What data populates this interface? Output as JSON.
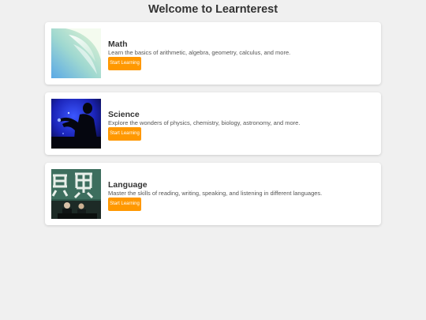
{
  "page": {
    "title": "Welcome to Learnterest"
  },
  "theme": {
    "background": "#f0f0f0",
    "card_background": "#ffffff",
    "accent": "#ff9800",
    "button_text": "#ffffff"
  },
  "courses": [
    {
      "title": "Math",
      "description": "Learn the basics of arithmetic, algebra, geometry, calculus, and more.",
      "button_label": "Start Learning",
      "image": "abstract-pastel-curve-image"
    },
    {
      "title": "Science",
      "description": "Explore the wonders of physics, chemistry, biology, astronomy, and more.",
      "button_label": "Start Learning",
      "image": "scientist-silhouette-blue-image"
    },
    {
      "title": "Language",
      "description": "Master the skills of reading, writing, speaking, and listening in different languages.",
      "button_label": "Start Learning",
      "image": "chinese-character-wall-image"
    }
  ]
}
